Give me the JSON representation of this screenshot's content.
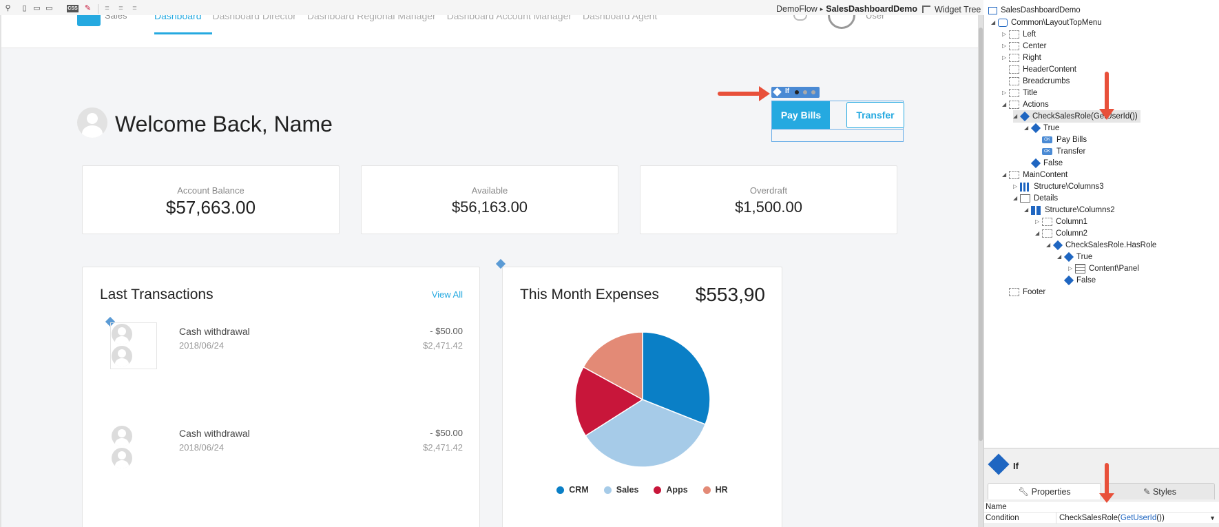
{
  "toolbar": {
    "breadcrumb_module": "DemoFlow",
    "breadcrumb_sep": "▸",
    "breadcrumb_screen": "SalesDashboardDemo",
    "widget_tree_label": "Widget Tree",
    "css_label": "CSS"
  },
  "app": {
    "logo_text": "Sales",
    "nav": [
      "Dashboard",
      "Dashboard Director",
      "Dashboard Regional Manager",
      "Dashboard Account Manager",
      "Dashboard Agent"
    ],
    "user_label": "User"
  },
  "if_widget": {
    "label": "If"
  },
  "actions": {
    "pay_bills": "Pay Bills",
    "transfer": "Transfer"
  },
  "welcome": "Welcome Back, Name",
  "cards": [
    {
      "label": "Account Balance",
      "value": "$57,663.00"
    },
    {
      "label": "Available",
      "value": "$56,163.00"
    },
    {
      "label": "Overdraft",
      "value": "$1,500.00"
    }
  ],
  "transactions": {
    "title": "Last Transactions",
    "view_all": "View All",
    "items": [
      {
        "desc": "Cash withdrawal",
        "date": "2018/06/24",
        "amount": "- $50.00",
        "balance": "$2,471.42"
      },
      {
        "desc": "Cash withdrawal",
        "date": "2018/06/24",
        "amount": "- $50.00",
        "balance": "$2,471.42"
      }
    ]
  },
  "expenses": {
    "title": "This Month Expenses",
    "total": "$553,90"
  },
  "chart_data": {
    "type": "pie",
    "categories": [
      "CRM",
      "Sales",
      "Apps",
      "HR"
    ],
    "values": [
      31,
      35,
      17,
      17
    ],
    "colors": [
      "#0a7fc6",
      "#a6cbe8",
      "#c8163a",
      "#e38a76"
    ],
    "legend_position": "bottom"
  },
  "tree": {
    "root": "SalesDashboardDemo",
    "rows": [
      {
        "label": "Common\\LayoutTopMenu",
        "icon": "block-icon"
      },
      {
        "label": "Left",
        "icon": "placeholder-icon"
      },
      {
        "label": "Center",
        "icon": "placeholder-icon"
      },
      {
        "label": "Right",
        "icon": "placeholder-icon"
      },
      {
        "label": "HeaderContent",
        "icon": "placeholder-icon"
      },
      {
        "label": "Breadcrumbs",
        "icon": "placeholder-icon"
      },
      {
        "label": "Title",
        "icon": "placeholder-icon"
      },
      {
        "label": "Actions",
        "icon": "placeholder-icon"
      },
      {
        "label": "CheckSalesRole(GetUserId())",
        "icon": "if-icon"
      },
      {
        "label": "True",
        "icon": "if-icon"
      },
      {
        "label": "Pay Bills",
        "icon": "button-icon"
      },
      {
        "label": "Transfer",
        "icon": "button-icon"
      },
      {
        "label": "False",
        "icon": "if-icon"
      },
      {
        "label": "MainContent",
        "icon": "placeholder-icon"
      },
      {
        "label": "Structure\\Columns3",
        "icon": "columns3-icon"
      },
      {
        "label": "Details",
        "icon": "container-icon"
      },
      {
        "label": "Structure\\Columns2",
        "icon": "columns2-icon"
      },
      {
        "label": "Column1",
        "icon": "placeholder-icon"
      },
      {
        "label": "Column2",
        "icon": "placeholder-icon"
      },
      {
        "label": "CheckSalesRole.HasRole",
        "icon": "if-icon"
      },
      {
        "label": "True",
        "icon": "if-icon"
      },
      {
        "label": "Content\\Panel",
        "icon": "panel-icon"
      },
      {
        "label": "False",
        "icon": "if-icon"
      },
      {
        "label": "Footer",
        "icon": "placeholder-icon"
      }
    ],
    "ok_badge": "OK"
  },
  "properties": {
    "widget_type": "If",
    "tab_properties": "Properties",
    "tab_styles": "Styles",
    "name_key": "Name",
    "name_value": "",
    "condition_key": "Condition",
    "condition_fn": "CheckSalesRole(",
    "condition_inner": "GetUserId",
    "condition_end": "())"
  },
  "colors": {
    "accent": "#25a9e0",
    "arrow": "#e8503a",
    "tree_icon": "#1f66c1"
  }
}
